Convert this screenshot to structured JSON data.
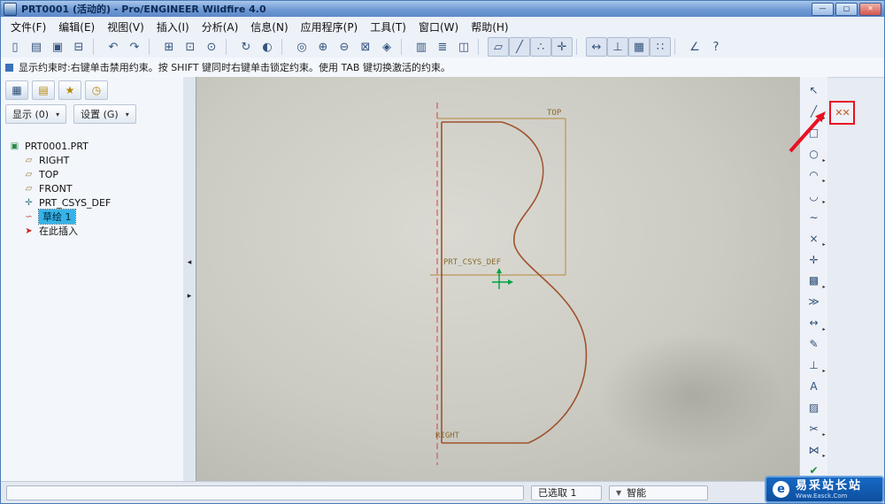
{
  "window": {
    "title": "PRT0001 (活动的) - Pro/ENGINEER Wildfire 4.0",
    "buttons": [
      {
        "name": "minimize-button",
        "icon": "minimize-icon",
        "glyph": "—"
      },
      {
        "name": "maximize-button",
        "icon": "maximize-icon",
        "glyph": "▢"
      },
      {
        "name": "close-button",
        "icon": "close-icon",
        "glyph": "✕"
      }
    ]
  },
  "menu": {
    "items": [
      "文件(F)",
      "编辑(E)",
      "视图(V)",
      "插入(I)",
      "分析(A)",
      "信息(N)",
      "应用程序(P)",
      "工具(T)",
      "窗口(W)",
      "帮助(H)"
    ]
  },
  "toolbar": {
    "items": [
      {
        "name": "new-button",
        "icon": "new-file-icon",
        "glyph": "▯",
        "kind": "btn",
        "inter": "true"
      },
      {
        "name": "open-button",
        "icon": "open-folder-icon",
        "glyph": "▤",
        "kind": "btn",
        "inter": "true"
      },
      {
        "name": "save-button",
        "icon": "save-icon",
        "glyph": "▣",
        "kind": "btn",
        "inter": "true"
      },
      {
        "name": "print-button",
        "icon": "print-icon",
        "glyph": "⊟",
        "kind": "btn",
        "inter": "true"
      },
      {
        "name": "toolbar-separator",
        "icon": "separator",
        "glyph": "",
        "kind": "sep",
        "inter": "false"
      },
      {
        "name": "undo-button",
        "icon": "undo-icon",
        "glyph": "↶",
        "kind": "btn",
        "inter": "true"
      },
      {
        "name": "redo-button",
        "icon": "redo-icon",
        "glyph": "↷",
        "kind": "btn",
        "inter": "true"
      },
      {
        "name": "toolbar-separator",
        "icon": "separator",
        "glyph": "",
        "kind": "sep",
        "inter": "false"
      },
      {
        "name": "copy-button",
        "icon": "copy-icon",
        "glyph": "⊞",
        "kind": "btn",
        "inter": "true"
      },
      {
        "name": "paste-button",
        "icon": "paste-icon",
        "glyph": "⊡",
        "kind": "btn",
        "inter": "true"
      },
      {
        "name": "find-button",
        "icon": "find-icon",
        "glyph": "⊙",
        "kind": "btn",
        "inter": "true"
      },
      {
        "name": "toolbar-separator",
        "icon": "separator",
        "glyph": "",
        "kind": "sep",
        "inter": "false"
      },
      {
        "name": "repaint-button",
        "icon": "repaint-icon",
        "glyph": "↻",
        "kind": "btn",
        "inter": "true"
      },
      {
        "name": "shade-button",
        "icon": "shade-icon",
        "glyph": "◐",
        "kind": "btn",
        "inter": "true"
      },
      {
        "name": "toolbar-separator",
        "icon": "separator",
        "glyph": "",
        "kind": "sep",
        "inter": "false"
      },
      {
        "name": "spin-center-button",
        "icon": "spin-center-icon",
        "glyph": "◎",
        "kind": "btn",
        "inter": "true"
      },
      {
        "name": "zoom-in-button",
        "icon": "zoom-in-icon",
        "glyph": "⊕",
        "kind": "btn",
        "inter": "true"
      },
      {
        "name": "zoom-out-button",
        "icon": "zoom-out-icon",
        "glyph": "⊖",
        "kind": "btn",
        "inter": "true"
      },
      {
        "name": "refit-button",
        "icon": "refit-icon",
        "glyph": "⊠",
        "kind": "btn",
        "inter": "true"
      },
      {
        "name": "reorient-button",
        "icon": "reorient-icon",
        "glyph": "◈",
        "kind": "btn",
        "inter": "true"
      },
      {
        "name": "toolbar-separator",
        "icon": "separator",
        "glyph": "",
        "kind": "sep",
        "inter": "false"
      },
      {
        "name": "saved-views-button",
        "icon": "saved-views-icon",
        "glyph": "▥",
        "kind": "btn",
        "inter": "true"
      },
      {
        "name": "layers-button",
        "icon": "layers-icon",
        "glyph": "≣",
        "kind": "btn",
        "inter": "true"
      },
      {
        "name": "view-manager-button",
        "icon": "view-manager-icon",
        "glyph": "◫",
        "kind": "btn",
        "inter": "true"
      },
      {
        "name": "toolbar-separator",
        "icon": "separator",
        "glyph": "",
        "kind": "sep",
        "inter": "false"
      },
      {
        "name": "datum-planes-toggle",
        "icon": "datum-plane-icon",
        "glyph": "▱",
        "kind": "btn",
        "inter": "true"
      },
      {
        "name": "datum-axes-toggle",
        "icon": "datum-axis-icon",
        "glyph": "╱",
        "kind": "btn",
        "inter": "true"
      },
      {
        "name": "datum-points-toggle",
        "icon": "datum-point-icon",
        "glyph": "∴",
        "kind": "btn",
        "inter": "true"
      },
      {
        "name": "datum-csys-toggle",
        "icon": "datum-csys-icon",
        "glyph": "✛",
        "kind": "btn",
        "inter": "true"
      },
      {
        "name": "toolbar-separator",
        "icon": "separator",
        "glyph": "",
        "kind": "sep",
        "inter": "false"
      },
      {
        "name": "dims-display-toggle",
        "icon": "dimension-icon",
        "glyph": "↔",
        "kind": "btn",
        "inter": "true"
      },
      {
        "name": "constraints-display-toggle",
        "icon": "constraint-icon",
        "glyph": "⊥",
        "kind": "btn",
        "inter": "true"
      },
      {
        "name": "grid-display-toggle",
        "icon": "grid-icon",
        "glyph": "▦",
        "kind": "btn",
        "inter": "true"
      },
      {
        "name": "vertices-display-toggle",
        "icon": "vertex-icon",
        "glyph": "∷",
        "kind": "btn",
        "inter": "true"
      },
      {
        "name": "toolbar-separator",
        "icon": "separator",
        "glyph": "",
        "kind": "sep",
        "inter": "false"
      },
      {
        "name": "sketch-orient-button",
        "icon": "sketch-orient-icon",
        "glyph": "∠",
        "kind": "btn",
        "inter": "true"
      },
      {
        "name": "context-help-button",
        "icon": "help-icon",
        "glyph": "?",
        "kind": "btn",
        "inter": "true"
      }
    ]
  },
  "message_bar": {
    "text": "显示约束时:右键单击禁用约束。按 SHIFT 键同时右键单击锁定约束。使用 TAB 键切换激活的约束。"
  },
  "navigator": {
    "tabs": [
      {
        "name": "model-tree-tab",
        "icon": "tree-icon",
        "glyph": "▦"
      },
      {
        "name": "folder-browser-tab",
        "icon": "folder-icon",
        "glyph": "▤"
      },
      {
        "name": "favorites-tab",
        "icon": "star-icon",
        "glyph": "★"
      },
      {
        "name": "history-tab",
        "icon": "clock-icon",
        "glyph": "◷"
      }
    ],
    "show_button": "显示 (0)",
    "settings_button": "设置 (G)",
    "dropdown_arrow": "▾",
    "tree": [
      {
        "label": "PRT0001.PRT",
        "icon": "part-icon",
        "glyph": "▣",
        "indent": "0",
        "state": "normal"
      },
      {
        "label": "RIGHT",
        "icon": "datum-plane-icon",
        "glyph": "▱",
        "indent": "1",
        "state": "normal"
      },
      {
        "label": "TOP",
        "icon": "datum-plane-icon",
        "glyph": "▱",
        "indent": "1",
        "state": "normal"
      },
      {
        "label": "FRONT",
        "icon": "datum-plane-icon",
        "glyph": "▱",
        "indent": "1",
        "state": "normal"
      },
      {
        "label": "PRT_CSYS_DEF",
        "icon": "csys-icon",
        "glyph": "✛",
        "indent": "1",
        "state": "normal"
      },
      {
        "label": "草绘 1",
        "icon": "sketch-icon",
        "glyph": "∽",
        "indent": "1",
        "state": "selected"
      },
      {
        "label": "在此插入",
        "icon": "insert-here-icon",
        "glyph": "➤",
        "indent": "1",
        "state": "normal"
      }
    ]
  },
  "sash": {
    "left_arrow": "◂",
    "right_arrow": "▸"
  },
  "canvas": {
    "labels": {
      "top": "TOP",
      "csys": "PRT_CSYS_DEF",
      "right": "RIGHT"
    }
  },
  "sketch_tools": {
    "items": [
      {
        "name": "select-tool",
        "icon": "select-arrow-icon",
        "glyph": "↖",
        "flyout": "false"
      },
      {
        "name": "line-tool",
        "icon": "line-icon",
        "glyph": "╱",
        "flyout": "true"
      },
      {
        "name": "rectangle-tool",
        "icon": "rectangle-icon",
        "glyph": "□",
        "flyout": "false"
      },
      {
        "name": "circle-tool",
        "icon": "circle-icon",
        "glyph": "○",
        "flyout": "true"
      },
      {
        "name": "arc-tool",
        "icon": "arc-icon",
        "glyph": "◠",
        "flyout": "true"
      },
      {
        "name": "fillet-tool",
        "icon": "fillet-icon",
        "glyph": "◡",
        "flyout": "true"
      },
      {
        "name": "spline-tool",
        "icon": "spline-icon",
        "glyph": "∼",
        "flyout": "false"
      },
      {
        "name": "point-tool",
        "icon": "point-icon",
        "glyph": "×",
        "flyout": "true"
      },
      {
        "name": "csys-tool",
        "icon": "csys-icon",
        "glyph": "✛",
        "flyout": "false"
      },
      {
        "name": "use-edge-tool",
        "icon": "use-edge-icon",
        "glyph": "▩",
        "flyout": "true"
      },
      {
        "name": "offset-tool",
        "icon": "offset-icon",
        "glyph": "≫",
        "flyout": "false"
      },
      {
        "name": "dimension-tool",
        "icon": "dimension-icon",
        "glyph": "↔",
        "flyout": "true"
      },
      {
        "name": "modify-tool",
        "icon": "modify-icon",
        "glyph": "✎",
        "flyout": "false"
      },
      {
        "name": "constraint-tool",
        "icon": "constraint-icon",
        "glyph": "⊥",
        "flyout": "true"
      },
      {
        "name": "text-tool",
        "icon": "text-icon",
        "glyph": "A",
        "flyout": "false"
      },
      {
        "name": "palette-tool",
        "icon": "palette-icon",
        "glyph": "▨",
        "flyout": "false"
      },
      {
        "name": "trim-tool",
        "icon": "trim-icon",
        "glyph": "✂",
        "flyout": "true"
      },
      {
        "name": "mirror-tool",
        "icon": "mirror-icon",
        "glyph": "⋈",
        "flyout": "true"
      },
      {
        "name": "done-tool",
        "icon": "check-icon",
        "glyph": "✔",
        "flyout": "false"
      }
    ]
  },
  "annotation": {
    "highlight_glyph": "✕✕"
  },
  "status_bar": {
    "message": "",
    "selection": "已选取 1",
    "filter_icon": "▼",
    "filter_label": "智能"
  },
  "watermark": {
    "logo": "e",
    "title": "易采站长站",
    "subtitle": "Www.Easck.Com"
  },
  "colors": {
    "highlight_red": "#e81123",
    "selection_blue": "#36b3e8",
    "sketch": "#a0522d",
    "centerline": "#cc4443",
    "datum": "#b8863b",
    "csys_green": "#00a33e",
    "label_brown": "#8b6b2e"
  }
}
